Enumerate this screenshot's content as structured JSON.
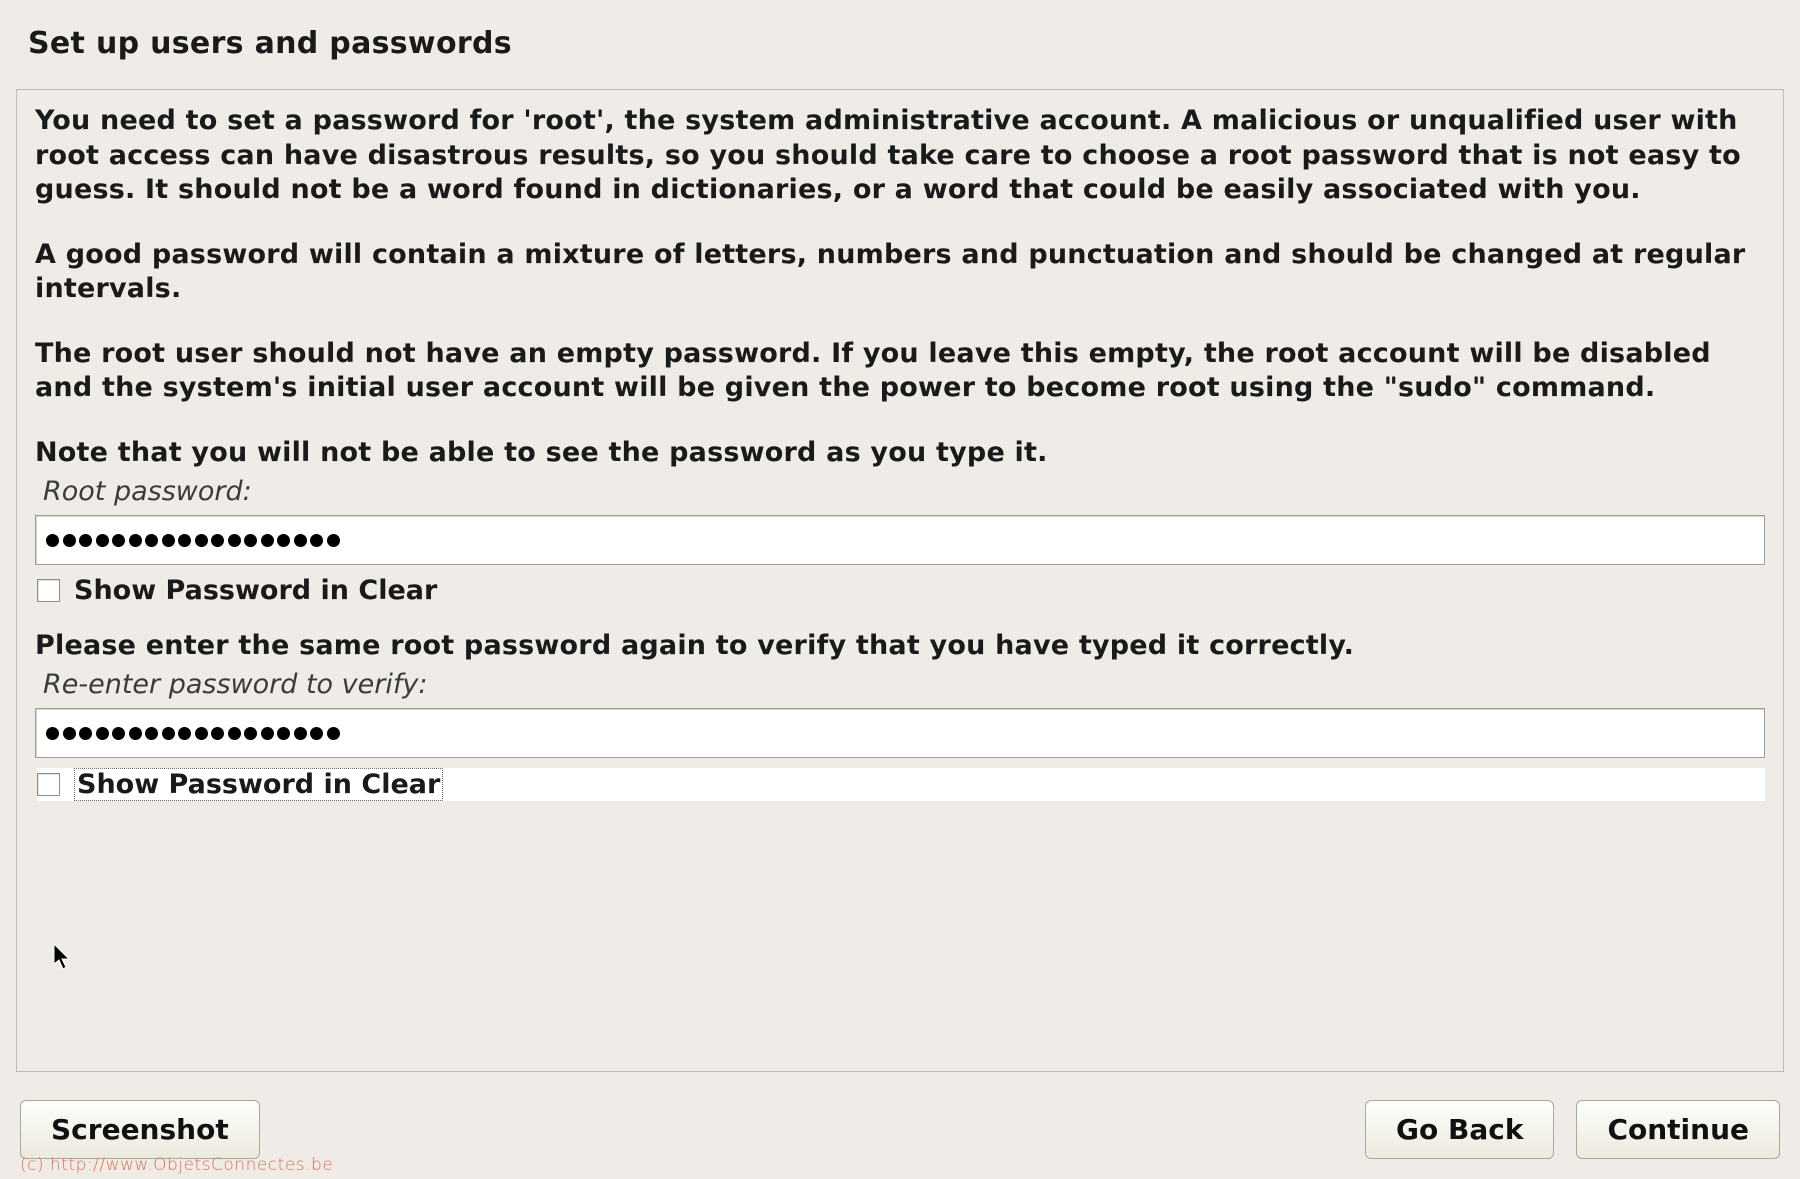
{
  "title": "Set up users and passwords",
  "paragraphs": {
    "p1": "You need to set a password for 'root', the system administrative account. A malicious or unqualified user with root access can have disastrous results, so you should take care to choose a root password that is not easy to guess. It should not be a word found in dictionaries, or a word that could be easily associated with you.",
    "p2": "A good password will contain a mixture of letters, numbers and punctuation and should be changed at regular intervals.",
    "p3": "The root user should not have an empty password. If you leave this empty, the root account will be disabled and the system's initial user account will be given the power to become root using the \"sudo\" command.",
    "p4": "Note that you will not be able to see the password as you type it."
  },
  "fields": {
    "root_label": "Root password:",
    "root_masked_len": 18,
    "verify_label": "Re-enter password to verify:",
    "verify_masked_len": 18
  },
  "verify_prompt": "Please enter the same root password again to verify that you have typed it correctly.",
  "checkboxes": {
    "show1_label": "Show Password in Clear",
    "show1_checked": false,
    "show2_label": "Show Password in Clear",
    "show2_checked": false
  },
  "buttons": {
    "screenshot": "Screenshot",
    "go_back": "Go Back",
    "continue": "Continue"
  },
  "watermark": "(c) http://www.ObjetsConnectes.be"
}
